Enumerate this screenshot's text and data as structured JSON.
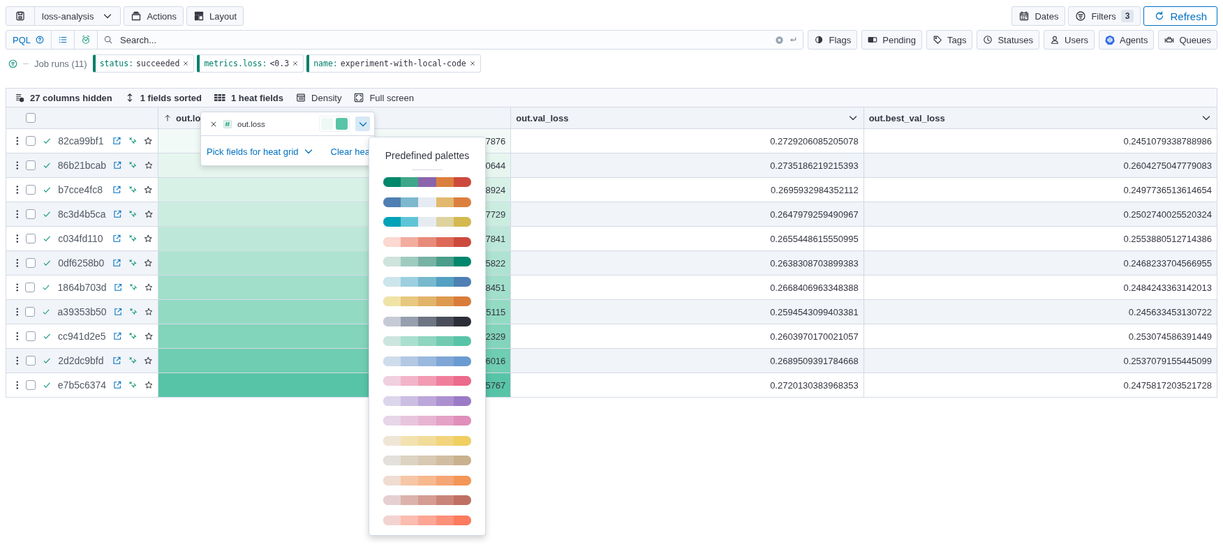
{
  "toolbar": {
    "view_name": "loss-analysis",
    "buttons": [
      "Actions",
      "Layout"
    ],
    "dates": "Dates",
    "filters": "Filters",
    "filters_count": "3",
    "refresh": "Refresh"
  },
  "query": {
    "mode": "PQL",
    "placeholder": "Search...",
    "facets": [
      {
        "kind": "flags",
        "label": "Flags"
      },
      {
        "kind": "pending",
        "label": "Pending"
      },
      {
        "kind": "tags",
        "label": "Tags"
      },
      {
        "kind": "statuses",
        "label": "Statuses"
      },
      {
        "kind": "users",
        "label": "Users"
      },
      {
        "kind": "agents",
        "label": "Agents"
      },
      {
        "kind": "queues",
        "label": "Queues"
      }
    ]
  },
  "filters": {
    "label": "Job runs (11)",
    "chips": [
      {
        "key": "status:",
        "value": "succeeded"
      },
      {
        "key": "metrics.loss:",
        "value": "<0.3"
      },
      {
        "key": "name:",
        "value": "experiment-with-local-code"
      }
    ]
  },
  "table_toolbar": [
    {
      "kind": "hidden",
      "label": "27 columns hidden"
    },
    {
      "kind": "sorted",
      "label": "1 fields sorted"
    },
    {
      "kind": "heat",
      "label": "1 heat fields"
    },
    {
      "kind": "density",
      "label": "Density"
    },
    {
      "kind": "fullscreen",
      "label": "Full screen"
    }
  ],
  "table": {
    "select_all_checked": false,
    "columns": [
      {
        "label": "out.lo",
        "sorted": true
      },
      {
        "label": "out.val_loss",
        "sorted": false
      },
      {
        "label": "out.best_val_loss",
        "sorted": false
      }
    ],
    "rows": [
      {
        "id": "82ca99bf1",
        "checked": false,
        "color": "#f2faf7",
        "out_loss": "7876",
        "val_loss": "0.2729206085205078",
        "best_val_loss": "0.2451079338788986"
      },
      {
        "id": "86b21bcab",
        "checked": false,
        "color": "#e6f6ef",
        "out_loss": "0644",
        "val_loss": "0.2735186219215393",
        "best_val_loss": "0.2604275047779083"
      },
      {
        "id": "b7cce4fc8",
        "checked": false,
        "color": "#d8f1e7",
        "out_loss": "8924",
        "val_loss": "0.2695932984352112",
        "best_val_loss": "0.2497736513614654"
      },
      {
        "id": "8c3d4b5ca",
        "checked": false,
        "color": "#cbede0",
        "out_loss": "7729",
        "val_loss": "0.2647979259490967",
        "best_val_loss": "0.2502740025520324"
      },
      {
        "id": "c034fd110",
        "checked": false,
        "color": "#bde8d9",
        "out_loss": "7841",
        "val_loss": "0.2655448615550995",
        "best_val_loss": "0.2553880512714386"
      },
      {
        "id": "0df6258b0",
        "checked": false,
        "color": "#afe3d1",
        "out_loss": "5822",
        "val_loss": "0.2638308703899383",
        "best_val_loss": "0.2468233704566955"
      },
      {
        "id": "1864b703d",
        "checked": false,
        "color": "#a1dfca",
        "out_loss": "8451",
        "val_loss": "0.2668406963348388",
        "best_val_loss": "0.2484243363142013"
      },
      {
        "id": "a39353b50",
        "checked": false,
        "color": "#93dac3",
        "out_loss": "5115",
        "val_loss": "0.2594543099403381",
        "best_val_loss": "0.245633453130722"
      },
      {
        "id": "cc941d2e5",
        "checked": false,
        "color": "#82d4ba",
        "out_loss": "2329",
        "val_loss": "0.2603970170021057",
        "best_val_loss": "0.253074586391449"
      },
      {
        "id": "2d2dc9bfd",
        "checked": false,
        "color": "#6fcdb1",
        "out_loss": "6016",
        "val_loss": "0.2689509391784668",
        "best_val_loss": "0.2537079155445099"
      },
      {
        "id": "e7b5c6374",
        "checked": false,
        "color": "#58c4a7",
        "out_loss": "5767",
        "val_loss": "0.2720130383968353",
        "best_val_loss": "0.2475817203521728"
      }
    ]
  },
  "heat_popover": {
    "field": "out.loss",
    "swatches": [
      {
        "color": "#eef8f4"
      },
      {
        "color": "#5ac4a6"
      }
    ],
    "pick": "Pick fields for heat grid",
    "clear": "Clear hea"
  },
  "palette_popover": {
    "title": "Predefined palettes",
    "palettes": [
      {
        "swatches": [
          {
            "color": "#00876c"
          },
          {
            "color": "#3fa68a"
          },
          {
            "color": "#8a65ab"
          },
          {
            "color": "#db7f3e"
          },
          {
            "color": "#cc4a3d"
          }
        ]
      },
      {
        "swatches": [
          {
            "color": "#4f7fb3"
          },
          {
            "color": "#7db8cf"
          },
          {
            "color": "#e6ebf2"
          },
          {
            "color": "#e2b86f"
          },
          {
            "color": "#dc7f3e"
          }
        ]
      },
      {
        "swatches": [
          {
            "color": "#00a2b8"
          },
          {
            "color": "#5fc5d6"
          },
          {
            "color": "#e6ebf2"
          },
          {
            "color": "#ded29e"
          },
          {
            "color": "#d4b851"
          }
        ]
      },
      {
        "swatches": [
          {
            "color": "#fbd8d0"
          },
          {
            "color": "#f2ad9f"
          },
          {
            "color": "#e88b7a"
          },
          {
            "color": "#dd6a58"
          },
          {
            "color": "#cc4a3d"
          }
        ]
      },
      {
        "swatches": [
          {
            "color": "#cde3dc"
          },
          {
            "color": "#9fcbbf"
          },
          {
            "color": "#76b3a4"
          },
          {
            "color": "#4a9d8a"
          },
          {
            "color": "#00876c"
          }
        ]
      },
      {
        "swatches": [
          {
            "color": "#cce5ec"
          },
          {
            "color": "#9ccfdf"
          },
          {
            "color": "#78b9ce"
          },
          {
            "color": "#54a0c2"
          },
          {
            "color": "#4f7fb3"
          }
        ]
      },
      {
        "swatches": [
          {
            "color": "#f0e3a6"
          },
          {
            "color": "#e8c87e"
          },
          {
            "color": "#e2b46a"
          },
          {
            "color": "#dd9a4e"
          },
          {
            "color": "#d97c3a"
          }
        ]
      },
      {
        "swatches": [
          {
            "color": "#c6cad6"
          },
          {
            "color": "#969fae"
          },
          {
            "color": "#6d7482"
          },
          {
            "color": "#4a4e5a"
          },
          {
            "color": "#2b2e36"
          }
        ]
      },
      {
        "swatches": [
          {
            "color": "#cce5df"
          },
          {
            "color": "#aadfcf"
          },
          {
            "color": "#8fd5c0"
          },
          {
            "color": "#72cbb0"
          },
          {
            "color": "#58c4a7"
          }
        ]
      },
      {
        "swatches": [
          {
            "color": "#cfdcec"
          },
          {
            "color": "#b3c8e3"
          },
          {
            "color": "#99b9de"
          },
          {
            "color": "#80a6d6"
          },
          {
            "color": "#6a9bd0"
          }
        ]
      },
      {
        "swatches": [
          {
            "color": "#f0cfdf"
          },
          {
            "color": "#f2b4c9"
          },
          {
            "color": "#f29bb3"
          },
          {
            "color": "#ef7f9c"
          },
          {
            "color": "#ec6a8b"
          }
        ]
      },
      {
        "swatches": [
          {
            "color": "#dcd6ec"
          },
          {
            "color": "#cbbee3"
          },
          {
            "color": "#bca6da"
          },
          {
            "color": "#ad90d0"
          },
          {
            "color": "#9c7bc6"
          }
        ]
      },
      {
        "swatches": [
          {
            "color": "#e6d6e8"
          },
          {
            "color": "#e8c5dc"
          },
          {
            "color": "#e7b5d2"
          },
          {
            "color": "#e4a2c6"
          },
          {
            "color": "#df8fb9"
          }
        ]
      },
      {
        "swatches": [
          {
            "color": "#efe6d6"
          },
          {
            "color": "#f2e2b0"
          },
          {
            "color": "#f2dc9a"
          },
          {
            "color": "#f2d47c"
          },
          {
            "color": "#f0ce62"
          }
        ]
      },
      {
        "swatches": [
          {
            "color": "#e3e0dc"
          },
          {
            "color": "#dcd3c3"
          },
          {
            "color": "#d7c9b2"
          },
          {
            "color": "#d1bea2"
          },
          {
            "color": "#cab18e"
          }
        ]
      },
      {
        "swatches": [
          {
            "color": "#f0dcd0"
          },
          {
            "color": "#f7c6a6"
          },
          {
            "color": "#f7b88e"
          },
          {
            "color": "#f6a574"
          },
          {
            "color": "#f39656"
          }
        ]
      },
      {
        "swatches": [
          {
            "color": "#e5d0d0"
          },
          {
            "color": "#dbb3ab"
          },
          {
            "color": "#d49c93"
          },
          {
            "color": "#c98478"
          },
          {
            "color": "#bf6f62"
          }
        ]
      },
      {
        "swatches": [
          {
            "color": "#f3d3d0"
          },
          {
            "color": "#fcbcaf"
          },
          {
            "color": "#fda694"
          },
          {
            "color": "#fc9079"
          },
          {
            "color": "#fc7a5e"
          }
        ]
      }
    ]
  }
}
